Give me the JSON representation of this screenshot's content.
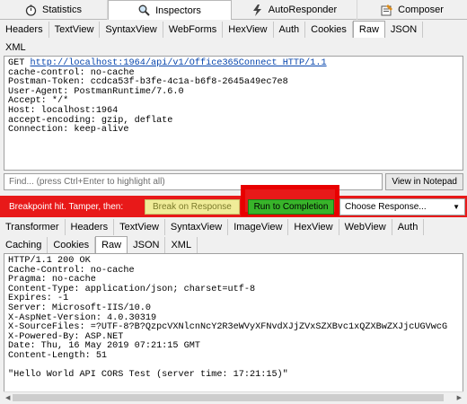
{
  "top_tabs": [
    {
      "label": "Statistics",
      "icon": "stopwatch-icon"
    },
    {
      "label": "Inspectors",
      "icon": "magnifier-icon",
      "selected": true
    },
    {
      "label": "AutoResponder",
      "icon": "lightning-icon"
    },
    {
      "label": "Composer",
      "icon": "composer-icon"
    }
  ],
  "request_tabs_row1": [
    "Headers",
    "TextView",
    "SyntaxView",
    "WebForms",
    "HexView",
    "Auth",
    "Cookies",
    "Raw",
    "JSON"
  ],
  "request_tabs_row2": [
    "XML"
  ],
  "request_selected": "Raw",
  "request": {
    "method": "GET ",
    "url": "http://localhost:1964/api/v1/Office365Connect HTTP/1.1",
    "lines": [
      "cache-control: no-cache",
      "Postman-Token: ccdca53f-b3fe-4c1a-b6f8-2645a49ec7e8",
      "User-Agent: PostmanRuntime/7.6.0",
      "Accept: */*",
      "Host: localhost:1964",
      "accept-encoding: gzip, deflate",
      "Connection: keep-alive"
    ]
  },
  "find": {
    "placeholder": "Find... (press Ctrl+Enter to highlight all)",
    "notepad_label": "View in Notepad"
  },
  "breakpoint": {
    "text": "Breakpoint hit. Tamper, then:",
    "break_on_response": "Break on Response",
    "run_to_completion": "Run to Completion",
    "choose_response": "Choose Response..."
  },
  "response_tabs_row1": [
    "Transformer",
    "Headers",
    "TextView",
    "SyntaxView",
    "ImageView",
    "HexView",
    "WebView",
    "Auth"
  ],
  "response_tabs_row2": [
    "Caching",
    "Cookies",
    "Raw",
    "JSON",
    "XML"
  ],
  "response_selected": "Raw",
  "response": {
    "lines": [
      "HTTP/1.1 200 OK",
      "Cache-Control: no-cache",
      "Pragma: no-cache",
      "Content-Type: application/json; charset=utf-8",
      "Expires: -1",
      "Server: Microsoft-IIS/10.0",
      "X-AspNet-Version: 4.0.30319",
      "X-SourceFiles: =?UTF-8?B?QzpcVXNlcnNcY2R3eWVyXFNvdXJjZVxSZXBvc1xQZXBwZXJjcUGVwcG",
      "X-Powered-By: ASP.NET",
      "Date: Thu, 16 May 2019 07:21:15 GMT",
      "Content-Length: 51",
      "",
      "\"Hello World API CORS Test (server time: 17:21:15)\""
    ]
  },
  "colors": {
    "breakpoint_bar": "#e81919",
    "run_button": "#38b42a",
    "highlight_box": "#e80000",
    "break_button": "#f0ec98"
  }
}
